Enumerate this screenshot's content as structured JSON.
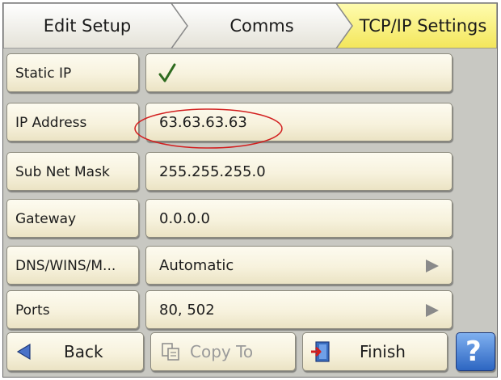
{
  "breadcrumb": [
    {
      "label": "Edit Setup"
    },
    {
      "label": "Comms"
    },
    {
      "label": "TCP/IP Settings"
    }
  ],
  "rows": [
    {
      "label": "Static IP",
      "value": "",
      "checked": true,
      "icon": "checkmark-icon"
    },
    {
      "label": "IP Address",
      "value": "63.63.63.63",
      "highlighted": true
    },
    {
      "label": "Sub Net Mask",
      "value": "255.255.255.0"
    },
    {
      "label": "Gateway",
      "value": "0.0.0.0"
    },
    {
      "label": "DNS/WINS/M...",
      "value": "Automatic",
      "icon": "arrow-right-icon"
    },
    {
      "label": "Ports",
      "value": "80, 502",
      "icon": "arrow-right-icon"
    }
  ],
  "footer": {
    "back_label": "Back",
    "copy_label": "Copy To",
    "finish_label": "Finish",
    "help_icon": "help-icon"
  },
  "colors": {
    "active_tab": "#fbf37a",
    "button_face": "#f7f2dd",
    "highlight_ellipse": "#d21f1f",
    "check": "#2e6b1f",
    "help": "#3f7fd0"
  }
}
